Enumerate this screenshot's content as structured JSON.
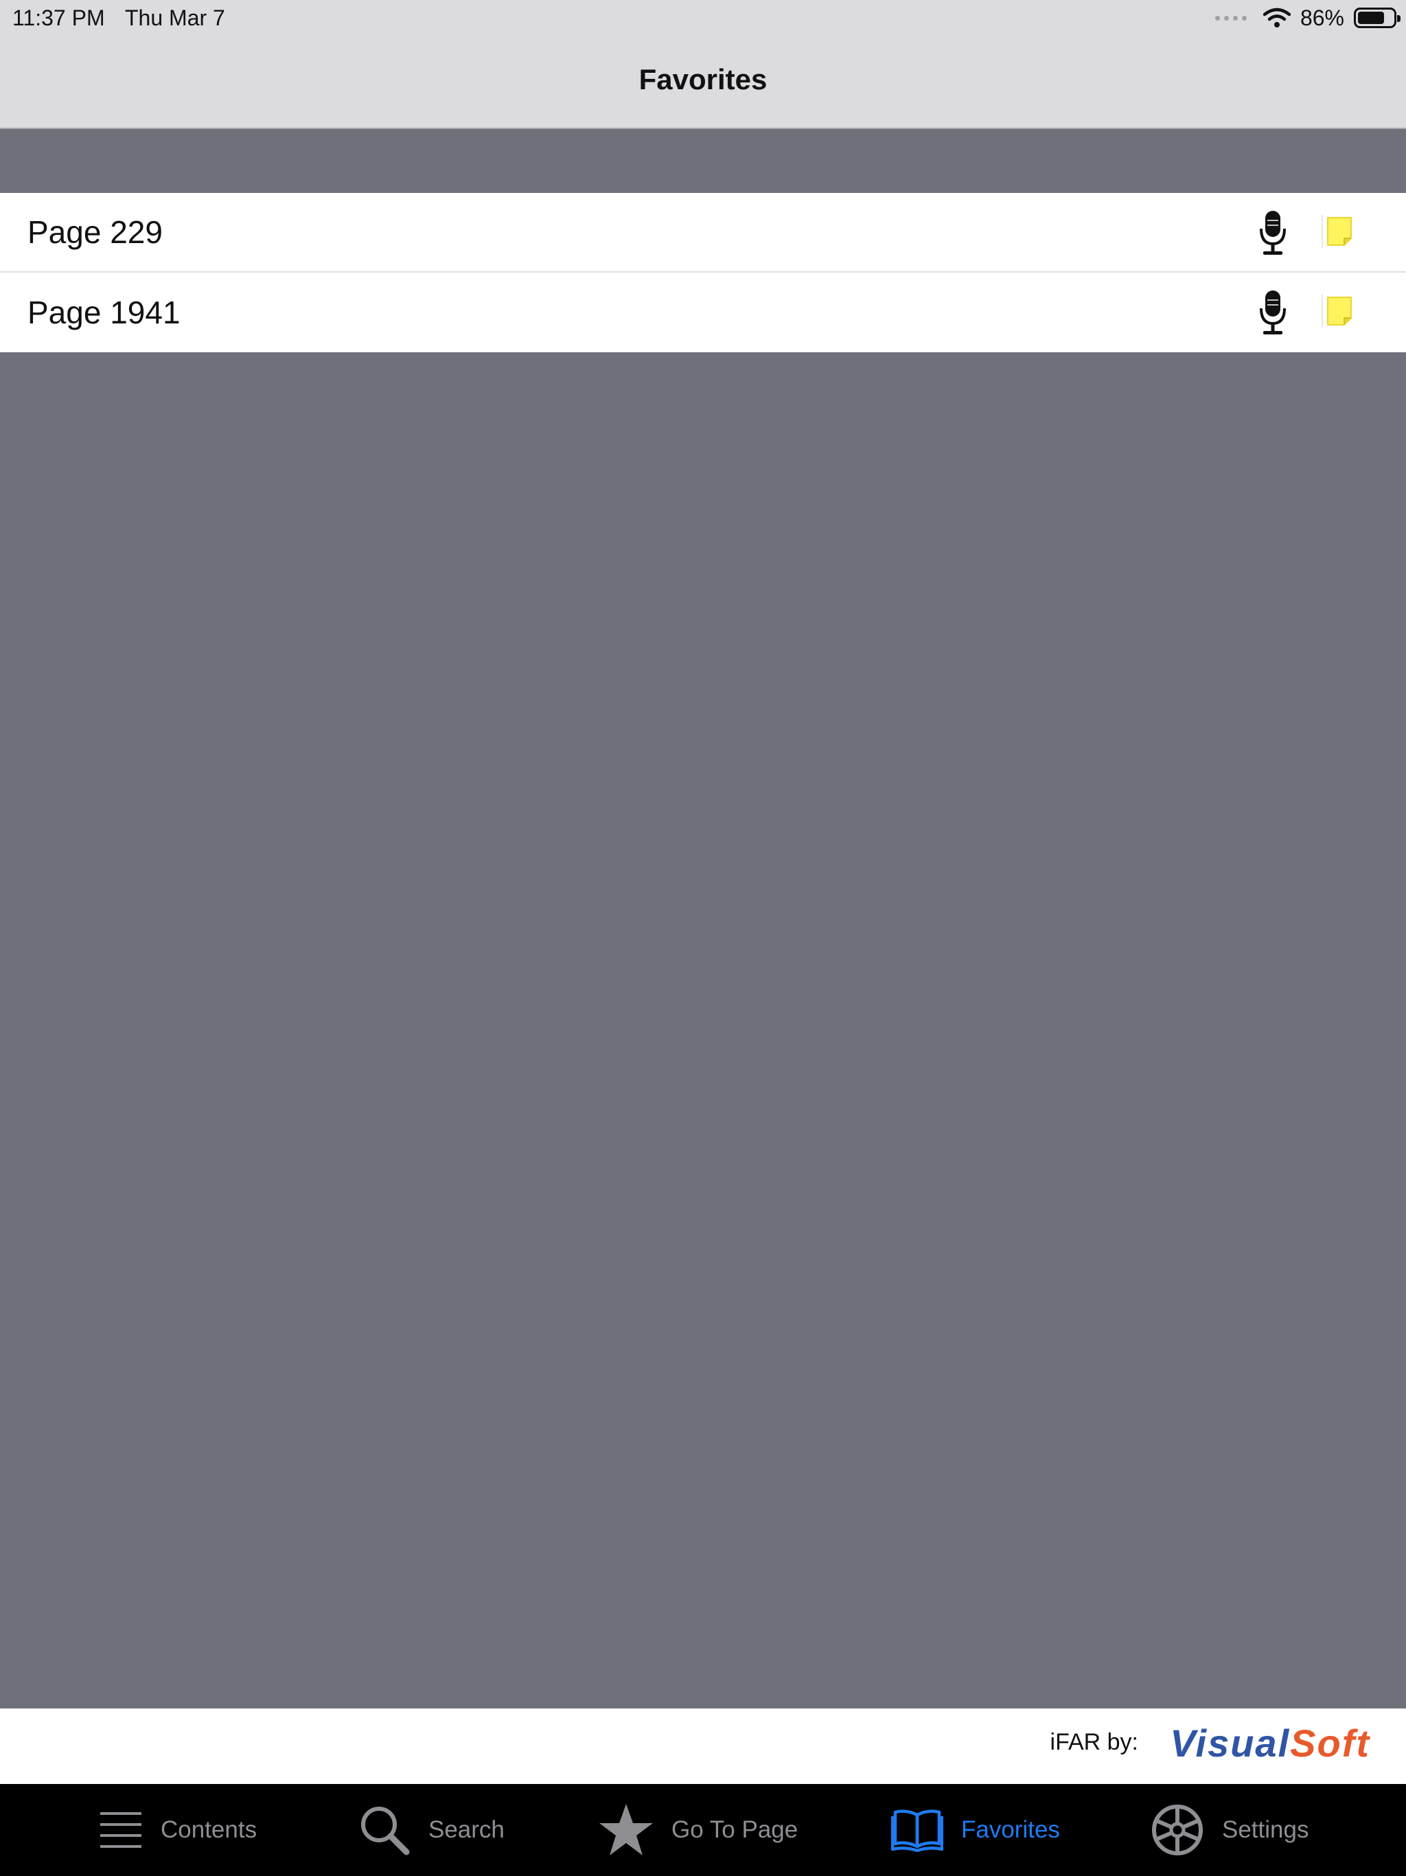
{
  "status_bar": {
    "time": "11:37 PM",
    "date": "Thu Mar 7",
    "battery_percent": "86%",
    "battery_level": 0.86,
    "icons": [
      "signal-dots-icon",
      "wifi-icon",
      "battery-icon"
    ]
  },
  "nav": {
    "title": "Favorites"
  },
  "favorites": [
    {
      "label": "Page 229",
      "mic_icon": "microphone-icon",
      "note_icon": "sticky-note-icon"
    },
    {
      "label": "Page 1941",
      "mic_icon": "microphone-icon",
      "note_icon": "sticky-note-icon"
    }
  ],
  "brand": {
    "prefix": "iFAR by:",
    "logo_part1": "Visual",
    "logo_part2": "Soft",
    "colors": {
      "visual": "#2f55a4",
      "soft": "#e85a2c"
    }
  },
  "tabs": [
    {
      "label": "Contents",
      "icon": "list-icon",
      "active": false
    },
    {
      "label": "Search",
      "icon": "search-icon",
      "active": false
    },
    {
      "label": "Go To Page",
      "icon": "star-icon",
      "active": false
    },
    {
      "label": "Favorites",
      "icon": "open-book-icon",
      "active": true
    },
    {
      "label": "Settings",
      "icon": "wheel-icon",
      "active": false
    }
  ],
  "colors": {
    "accent": "#1f7bf2",
    "background": "#6e717a",
    "nav_bar": "#dcdce0",
    "tab_bar": "#000000",
    "note_yellow": "#fff45e"
  }
}
